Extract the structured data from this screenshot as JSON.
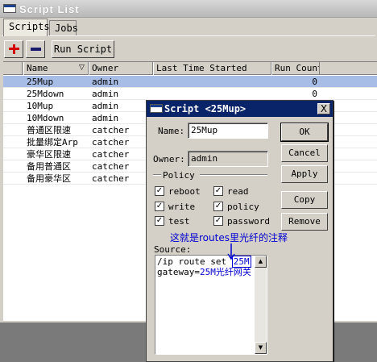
{
  "window": {
    "title": "Script List"
  },
  "tabs": [
    {
      "label": "Scripts"
    },
    {
      "label": "Jobs"
    }
  ],
  "toolbar": {
    "add_icon": "plus-icon",
    "remove_icon": "minus-icon",
    "run_label": "Run Script"
  },
  "table": {
    "columns": [
      "Name",
      "Owner",
      "Last Time Started",
      "Run Count"
    ],
    "rows": [
      {
        "name": "25Mup",
        "owner": "admin",
        "last": "",
        "count": "0"
      },
      {
        "name": "25Mdown",
        "owner": "admin",
        "last": "",
        "count": "0"
      },
      {
        "name": "10Mup",
        "owner": "admin",
        "last": "",
        "count": ""
      },
      {
        "name": "10Mdown",
        "owner": "admin",
        "last": "",
        "count": ""
      },
      {
        "name": "普通区限速",
        "owner": "catcher",
        "last": "",
        "count": ""
      },
      {
        "name": "批量绑定Arp",
        "owner": "catcher",
        "last": "",
        "count": ""
      },
      {
        "name": "豪华区限速",
        "owner": "catcher",
        "last": "",
        "count": ""
      },
      {
        "name": "备用普通区",
        "owner": "catcher",
        "last": "",
        "count": ""
      },
      {
        "name": "备用豪华区",
        "owner": "catcher",
        "last": "",
        "count": ""
      }
    ]
  },
  "dialog": {
    "title": "Script <25Mup>",
    "close": "X",
    "name_label": "Name:",
    "name_value": "25Mup",
    "owner_label": "Owner:",
    "owner_value": "admin",
    "policy_label": "Policy",
    "policies": [
      {
        "label": "reboot",
        "checked": true
      },
      {
        "label": "read",
        "checked": true
      },
      {
        "label": "write",
        "checked": true
      },
      {
        "label": "policy",
        "checked": true
      },
      {
        "label": "test",
        "checked": true
      },
      {
        "label": "password",
        "checked": true
      }
    ],
    "source_label": "Source:",
    "source_line1_pre": "/ip route set ",
    "source_line1_hl": "25M",
    "source_line2_pre": "gateway=",
    "source_line2_hl": "25M光纤网关",
    "buttons": {
      "ok": "OK",
      "cancel": "Cancel",
      "apply": "Apply",
      "copy": "Copy",
      "remove": "Remove"
    }
  },
  "annotation": "这就是routes里光纤的注释",
  "colors": {
    "selection": "#a8bde6",
    "annotation": "#0000d0",
    "dialog_title": "#0a246a"
  }
}
